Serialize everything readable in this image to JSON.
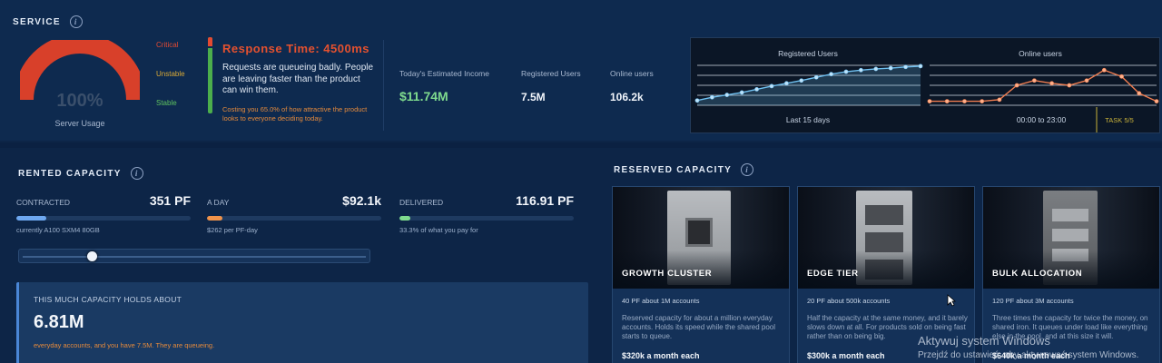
{
  "service": {
    "title": "SERVICE",
    "info": "i",
    "gauge": {
      "percent_text": "100%",
      "label": "Server Usage",
      "value": 100
    },
    "legend": {
      "critical": "Critical",
      "unstable": "Unstable",
      "stable": "Stable"
    },
    "response": {
      "title": "Response Time: 4500ms",
      "body": "Requests are queueing badly. People are leaving faster than the product can win them.",
      "note": "Costing you 65.0% of how attractive the product looks to everyone deciding today."
    },
    "stats": [
      {
        "label": "Today's Estimated Income",
        "value": "$11.74M"
      },
      {
        "label": "Registered Users",
        "value": "7.5M"
      },
      {
        "label": "Online users",
        "value": "106.2k"
      }
    ]
  },
  "charts": {
    "registered": {
      "title": "Registered Users",
      "footer": "Last 15 days",
      "values": [
        0.12,
        0.2,
        0.26,
        0.32,
        0.4,
        0.48,
        0.55,
        0.62,
        0.7,
        0.78,
        0.84,
        0.88,
        0.91,
        0.93,
        0.96,
        0.98
      ],
      "color": "#6fc0f0"
    },
    "online": {
      "title": "Online users",
      "footer": "00:00 to 23:00",
      "values": [
        0.1,
        0.1,
        0.1,
        0.1,
        0.14,
        0.5,
        0.62,
        0.55,
        0.5,
        0.62,
        0.88,
        0.72,
        0.3,
        0.1
      ],
      "color": "#f07d50"
    },
    "task": "TASK 5/5",
    "task_color": "#c9b23a"
  },
  "rented": {
    "title": "RENTED CAPACITY",
    "info": "i",
    "metrics": [
      {
        "label": "CONTRACTED",
        "value": "351 PF",
        "sub": "currently A100 SXM4 80GB",
        "fill": 0.17,
        "color": "#6ea8f0"
      },
      {
        "label": "A DAY",
        "value": "$92.1k",
        "sub": "$262 per PF-day",
        "fill": 0.09,
        "color": "#f0934a"
      },
      {
        "label": "DELIVERED",
        "value": "116.91 PF",
        "sub": "33.3% of what you pay for",
        "fill": 0.06,
        "color": "#7fdb8e"
      }
    ],
    "slider": 0.19,
    "hold": {
      "label": "THIS MUCH CAPACITY HOLDS ABOUT",
      "value": "6.81M",
      "note": "everyday accounts, and you have 7.5M. They are queueing."
    }
  },
  "reserved": {
    "title": "RESERVED CAPACITY",
    "info": "i",
    "cards": [
      {
        "name": "GROWTH CLUSTER",
        "tag": "40 PF about 1M accounts",
        "desc": "Reserved capacity for about a million everyday accounts. Holds its speed while the shared pool starts to queue.",
        "price": "$320k a month each"
      },
      {
        "name": "EDGE TIER",
        "tag": "20 PF about 500k accounts",
        "desc": "Half the capacity at the same money, and it barely slows down at all. For products sold on being fast rather than on being big.",
        "price": "$300k a month each"
      },
      {
        "name": "BULK ALLOCATION",
        "tag": "120 PF about 3M accounts",
        "desc": "Three times the capacity for twice the money, on shared iron. It queues under load like everything else in the pool, and at this size it will.",
        "price": "$640k a month each"
      }
    ]
  },
  "watermark": {
    "line1": "Aktywuj system Windows",
    "line2": "Przejdź do ustawień, aby aktywować system Windows."
  }
}
